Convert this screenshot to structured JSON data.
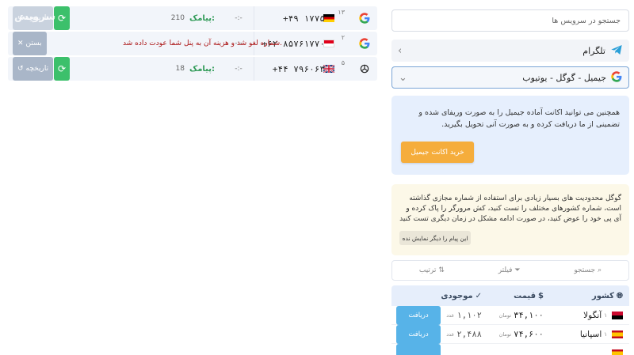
{
  "orders": [
    {
      "slot": "۱۳",
      "service_icon": "google-icon",
      "country": "germany",
      "phone": "+۴۹ ۱۷۷۵",
      "dash": "-:-",
      "message_label": "پیامک:",
      "message_code": "210",
      "refresh_label": "⟳",
      "history_label": "تاریخچه"
    },
    {
      "slot": "۲",
      "service_icon": "google-icon",
      "country": "indonesia",
      "phone": "+۶۲ ۸۵۷۶۱۷۷۰",
      "dash": "-:-",
      "notice": "شماره لغو شد و هزینه آن به پنل شما عودت داده شد.",
      "close_label": "بستن"
    },
    {
      "slot": "۵",
      "service_icon": "openai-icon",
      "country": "uk",
      "phone": "+۴۴ ۷۹۶۰۶۳",
      "dash": "-:-",
      "message_label": "پیامک:",
      "message_code": "18",
      "refresh_label": "⟳",
      "history_label": "تاریخچه"
    }
  ],
  "watermark": "سرویس",
  "search": {
    "placeholder": "جستجو در سرویس ها"
  },
  "category": {
    "label": "تلگرام"
  },
  "service_select": {
    "label": "جیمیل - گوگل - یوتیوب"
  },
  "info_blue": {
    "text": "همچنین می توانید اکانت آماده جیمیل را به صورت وریفای شده و تضمینی از ما دریافت کرده و به صورت آنی تحویل بگیرید.",
    "button": "خرید اکانت جیمیل"
  },
  "info_yellow": {
    "text": "گوگل محدودیت های بسیار زیادی برای استفاده از شماره مجازی گذاشته است، شماره کشورهای مختلف را تست کنید، کش مرورگر را پاک کرده و آی پی خود را عوض کنید، در صورت ادامه مشکل در زمان دیگری تست کنید",
    "dismiss": "این پیام را دیگر نمایش نده"
  },
  "toolbar": {
    "search": "جستجو",
    "filter": "فیلتر",
    "sort": "ترتیب"
  },
  "table": {
    "headers": {
      "country": "کشور",
      "price": "قیمت",
      "stock": "موجودی"
    },
    "rows": [
      {
        "country": "آنگولا",
        "sup": "۱",
        "price": "۳۴,۱۰۰",
        "price_unit": "تومان",
        "stock": "۱,۱۰۲",
        "stock_unit": "عدد",
        "button": "دریافت",
        "flag": "angola"
      },
      {
        "country": "اسپانیا",
        "sup": "۱",
        "price": "۷۴,۶۰۰",
        "price_unit": "تومان",
        "stock": "۲,۴۸۸",
        "stock_unit": "عدد",
        "button": "دریافت",
        "flag": "spain"
      },
      {
        "country": "",
        "sup": "",
        "price": "",
        "price_unit": "",
        "stock": "",
        "stock_unit": "",
        "button": "",
        "flag": "spain"
      }
    ]
  },
  "colors": {
    "green": "#3cc06b",
    "blue_button": "#57b3e8",
    "orange": "#f5ad3c",
    "sms_label": "#2f9a56"
  }
}
